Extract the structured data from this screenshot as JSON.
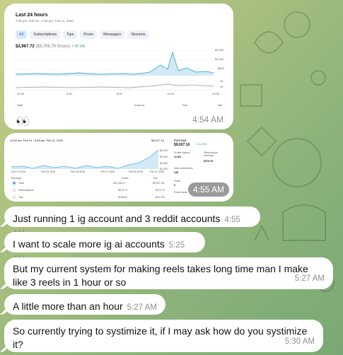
{
  "card1": {
    "title": "Last 24 hours",
    "subtitle": "7:53 pm, Feb 10 - 7:53 pm, Feb 11, 2026",
    "tabs": [
      "All",
      "Subscriptions",
      "Tips",
      "Posts",
      "Messages",
      "Streams"
    ],
    "active_tab": "All",
    "amount": "$2,967.72",
    "gross": "($3,709.70 Gross)",
    "change": "87.9%",
    "right_ticks_top": [
      "$1,500",
      "$1,000",
      "$500",
      "20",
      "10"
    ],
    "x_ticks": [
      "20:00",
      "2:00",
      "8:00",
      "14:00",
      "20:00"
    ],
    "footer_cols": [
      "Date",
      "Amount",
      "Fee",
      "Net"
    ],
    "emoji": "👀",
    "time": "4:54 AM"
  },
  "card2": {
    "header_left": "12:00 am, Feb 01 - 8:59 pm, Feb 11, 2026",
    "header_right": "$9,027.16",
    "y_ticks": [
      "$4,000",
      "$3,000",
      "$2,000",
      "$1,000"
    ],
    "x_ticks": [
      "Feb 01 2026",
      "Feb 03 2026",
      "Feb 05 2026",
      "Feb 07 2026",
      "Feb 09 2026",
      "Feb 11 2026"
    ],
    "table_headers": [
      "Earnings",
      "Gross",
      "Net"
    ],
    "rows": [
      {
        "label": "Total",
        "gross": "$11,284.17",
        "net": "$9,027.16"
      },
      {
        "label": "Subscriptions",
        "gross": "$474.73",
        "net": "$379.78"
      },
      {
        "label": "Tips",
        "gross": "$248.81",
        "net": "$211.53"
      }
    ],
    "earnings_label": "Earnings",
    "earnings_value": "$9,027.16",
    "earnings_change": "113.0%",
    "profile_visitors_label": "Profile visitors",
    "profile_visitors_value": "12.8%",
    "sub_earnings_label": "Subscription earnings",
    "sub_earnings_value": "$379.78",
    "new_subs_label": "New subscribers",
    "new_subs_value": "145",
    "posts_label": "Posts",
    "posts_value": "0",
    "posts_views_label": "Posts views",
    "time": "4:55 AM"
  },
  "messages": [
    {
      "text": "Just running 1 ig account and 3 reddit accounts",
      "time": "4:55 AM"
    },
    {
      "text": "I want to scale more ig ai accounts",
      "time": "5:25 AM"
    },
    {
      "text": "But my current system for making reels takes long time man I make like 3 reels in 1 hour or so",
      "time": "5:27 AM"
    },
    {
      "text": "A little more than an hour",
      "time": "5:27 AM"
    },
    {
      "text": "So currently trying to systimize it, if I may ask how do you systimize it?",
      "time": "5:30 AM"
    }
  ]
}
